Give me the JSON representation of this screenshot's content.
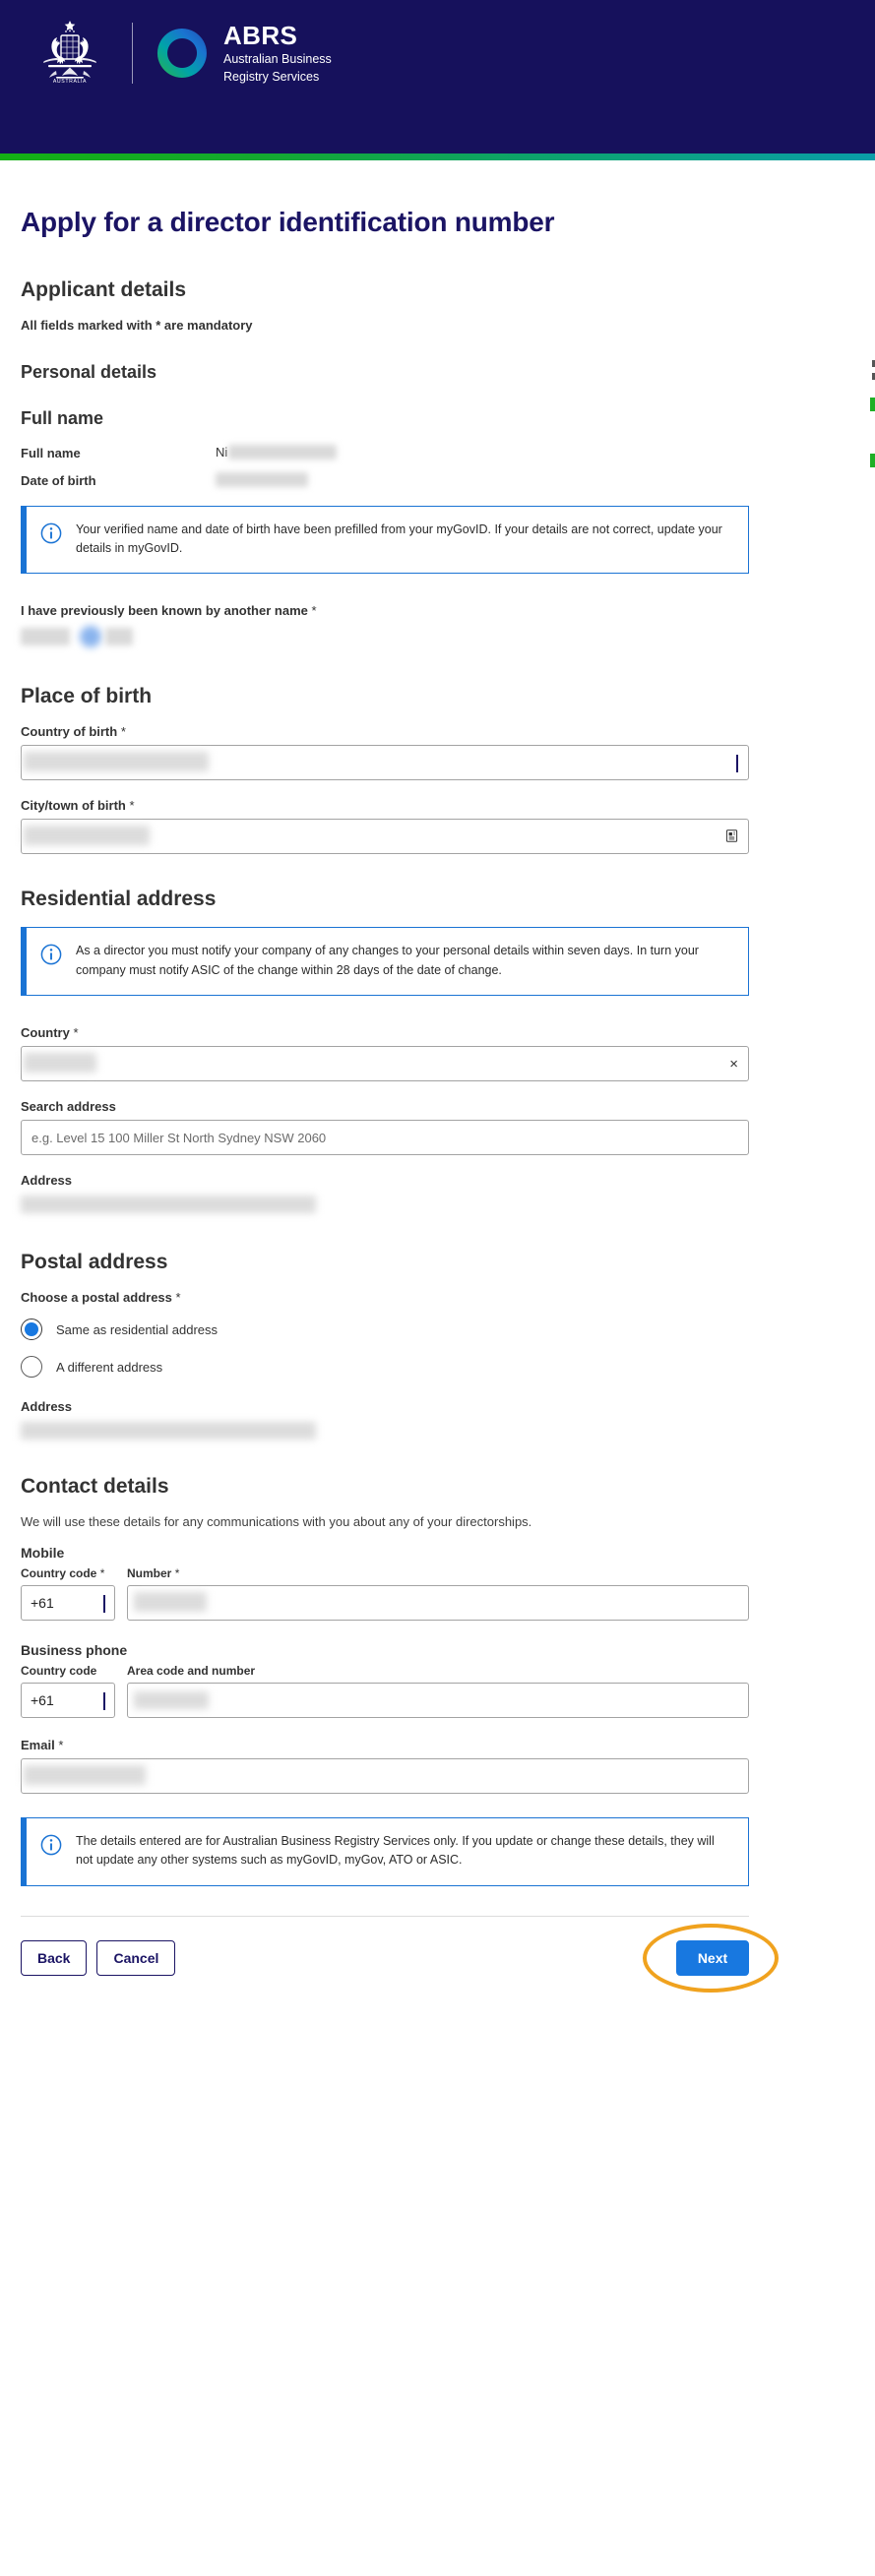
{
  "header": {
    "logo_alt": "Australian Government Coat of Arms",
    "brand_title": "ABRS",
    "brand_sub_line1": "Australian Business",
    "brand_sub_line2": "Registry Services",
    "accent_start": "#14b014",
    "accent_end": "#0a9ea8",
    "background": "#16115c"
  },
  "page": {
    "title": "Apply for a director identification number",
    "section_applicant": "Applicant details",
    "mandatory_note": "All fields marked with * are mandatory"
  },
  "personal": {
    "heading": "Personal details",
    "full_name_heading": "Full name",
    "full_name_label": "Full name",
    "full_name_value_prefix": "Ni",
    "dob_label": "Date of birth",
    "dob_value": "",
    "callout": "Your verified name and date of birth have been prefilled from your myGovID. If your details are not correct, update your details in myGovID.",
    "previous_name_label": "I have previously been known by another name",
    "previous_name_required": "*"
  },
  "place_of_birth": {
    "heading": "Place of birth",
    "country_label": "Country of birth",
    "country_required": "*",
    "country_value": "",
    "city_label": "City/town of birth",
    "city_required": "*",
    "city_value": ""
  },
  "residential": {
    "heading": "Residential address",
    "callout": "As a director you must notify your company of any changes to your personal details within seven days. In turn your company must notify ASIC of the change within 28 days of the date of change.",
    "country_label": "Country",
    "country_required": "*",
    "country_value": "",
    "clear_icon": "×",
    "search_label": "Search address",
    "search_placeholder": "e.g. Level 15 100 Miller St North Sydney NSW 2060",
    "search_value": "",
    "address_label": "Address",
    "address_value": ""
  },
  "postal": {
    "heading": "Postal address",
    "choose_label": "Choose a postal address",
    "choose_required": "*",
    "option_same": "Same as residential address",
    "option_different": "A different address",
    "selected": "Same as residential address",
    "address_label": "Address",
    "address_value": ""
  },
  "contact": {
    "heading": "Contact details",
    "helper": "We will use these details for any communications with you about any of your directorships.",
    "mobile_heading": "Mobile",
    "mobile_cc_label": "Country code",
    "mobile_cc_required": "*",
    "mobile_cc_value": "+61",
    "mobile_number_label": "Number",
    "mobile_number_required": "*",
    "mobile_number_value": "",
    "business_heading": "Business phone",
    "business_cc_label": "Country code",
    "business_cc_value": "+61",
    "business_number_label": "Area code and number",
    "business_number_value": "",
    "email_label": "Email",
    "email_required": "*",
    "email_value": "",
    "callout": "The details entered are for Australian Business Registry Services only. If you update or change these details, they will not update any other systems such as myGovID, myGov, ATO or ASIC."
  },
  "actions": {
    "back_label": "Back",
    "cancel_label": "Cancel",
    "next_label": "Next",
    "primary_color": "#1878e0",
    "highlight_color": "#f0a21e"
  }
}
